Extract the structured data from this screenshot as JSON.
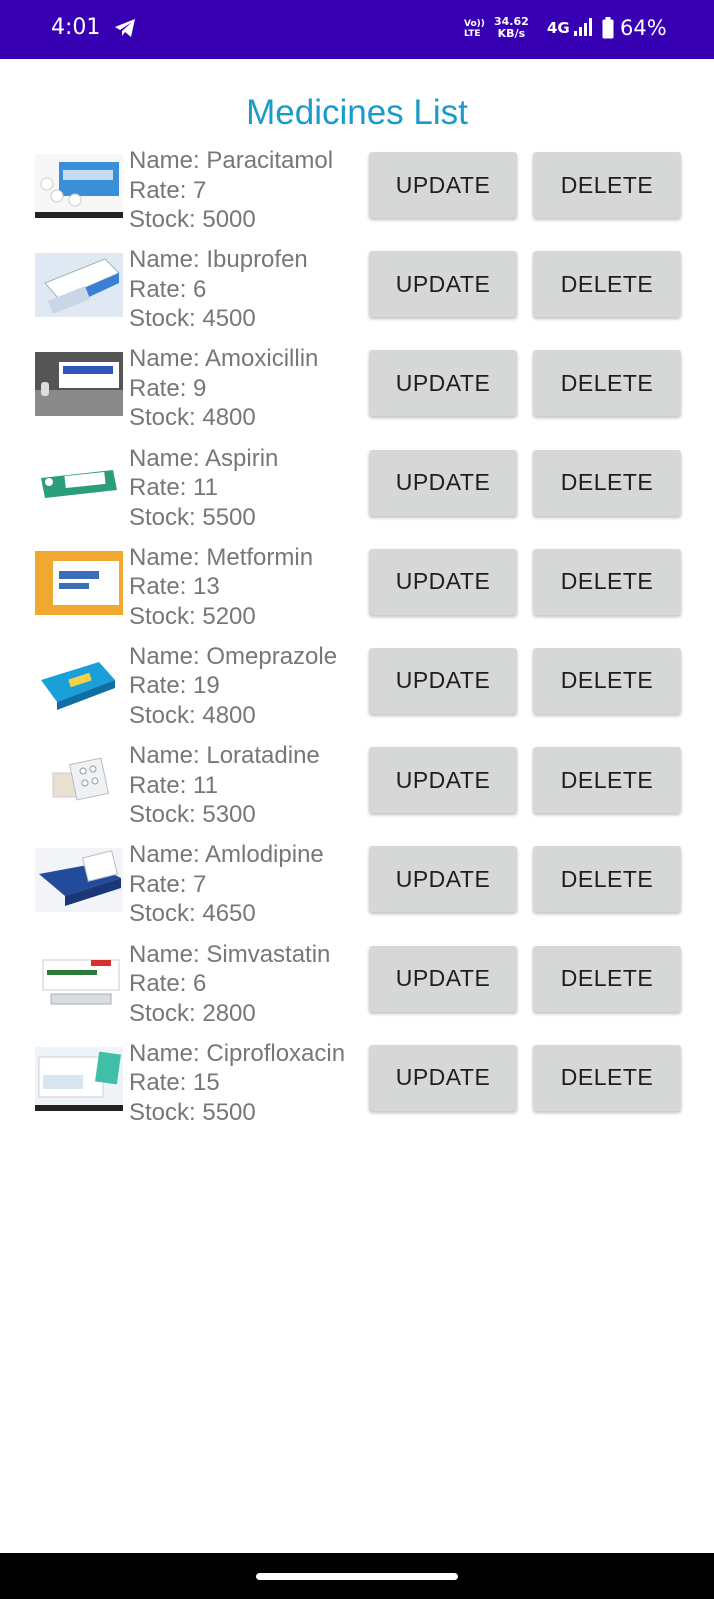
{
  "status_bar": {
    "time": "4:01",
    "volte_line1": "Vo))",
    "volte_line2": "LTE",
    "speed_value": "34.62",
    "speed_unit": "KB/s",
    "network": "4G",
    "battery": "64%",
    "background_color": "#3700b3"
  },
  "title": "Medicines List",
  "buttons": {
    "update": "UPDATE",
    "delete": "DELETE"
  },
  "medicines": [
    {
      "name": "Name: Paracitamol",
      "rate": "Rate: 7",
      "stock": "Stock: 5000"
    },
    {
      "name": "Name: Ibuprofen",
      "rate": "Rate: 6",
      "stock": "Stock: 4500"
    },
    {
      "name": "Name: Amoxicillin",
      "rate": "Rate: 9",
      "stock": "Stock: 4800"
    },
    {
      "name": "Name: Aspirin",
      "rate": "Rate: 11",
      "stock": "Stock: 5500"
    },
    {
      "name": "Name: Metformin",
      "rate": "Rate: 13",
      "stock": "Stock: 5200"
    },
    {
      "name": "Name: Omeprazole",
      "rate": "Rate: 19",
      "stock": "Stock: 4800"
    },
    {
      "name": "Name: Loratadine",
      "rate": "Rate: 11",
      "stock": "Stock: 5300"
    },
    {
      "name": "Name: Amlodipine",
      "rate": "Rate: 7",
      "stock": "Stock: 4650"
    },
    {
      "name": "Name: Simvastatin",
      "rate": "Rate: 6",
      "stock": "Stock: 2800"
    },
    {
      "name": "Name: Ciprofloxacin",
      "rate": "Rate: 15",
      "stock": "Stock: 5500"
    }
  ]
}
